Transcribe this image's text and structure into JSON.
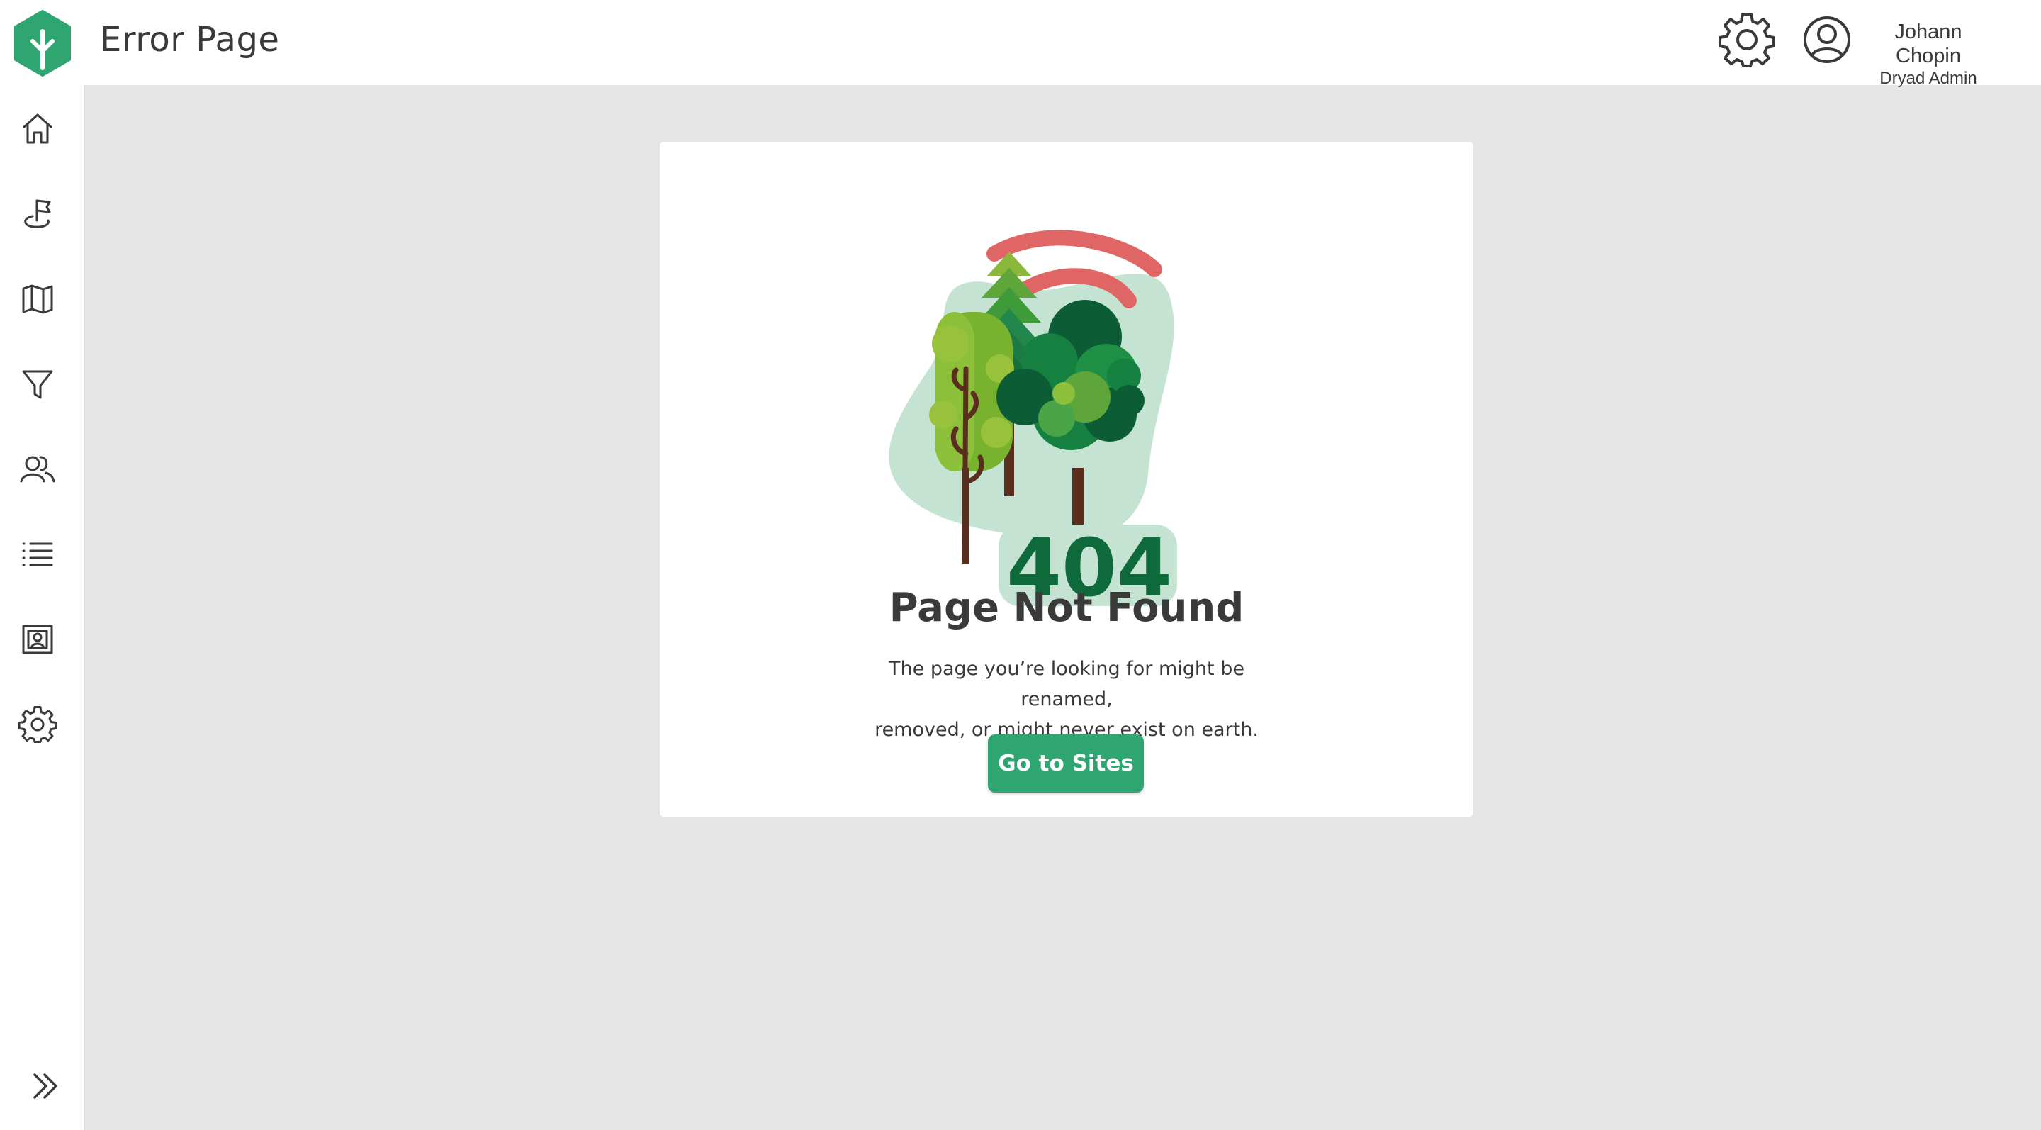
{
  "header": {
    "title": "Error Page",
    "user": {
      "name": "Johann Chopin",
      "role": "Dryad Admin"
    }
  },
  "sidebar": {
    "items": [
      {
        "icon": "home-icon"
      },
      {
        "icon": "planting-site-icon"
      },
      {
        "icon": "map-icon"
      },
      {
        "icon": "filter-icon"
      },
      {
        "icon": "people-icon"
      },
      {
        "icon": "list-icon"
      },
      {
        "icon": "image-gallery-icon"
      },
      {
        "icon": "gear-icon"
      }
    ],
    "collapse_icon": "double-chevron-right-icon"
  },
  "error": {
    "code": "404",
    "title": "Page Not Found",
    "description_line1": "The page you’re looking for might be renamed,",
    "description_line2": "removed, or might never exist on earth.",
    "button_label": "Go to Sites"
  },
  "colors": {
    "brand_green": "#2fa672",
    "dark_green": "#0e6a3a",
    "signal_red": "#e06666",
    "blob": "#c5e3d2",
    "background": "#e5e5e5"
  }
}
